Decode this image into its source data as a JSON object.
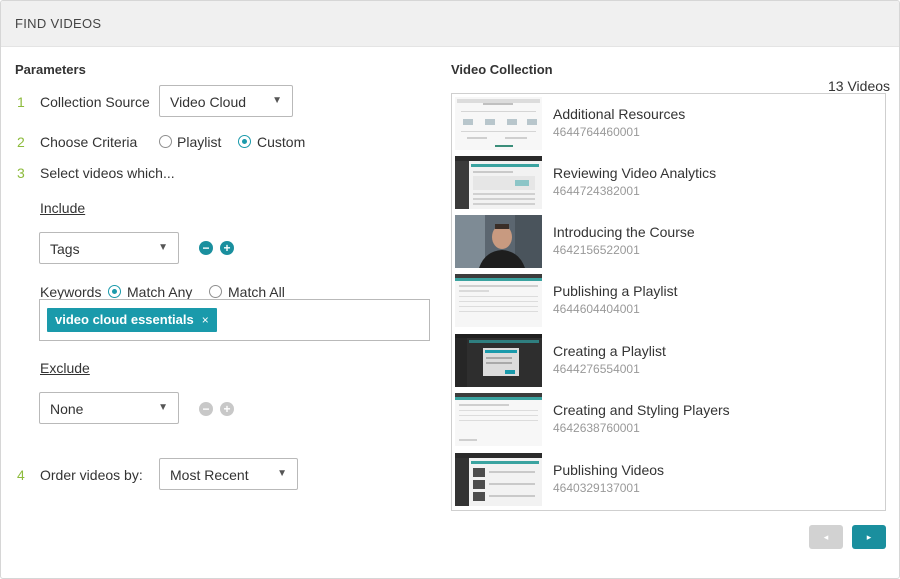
{
  "window": {
    "title": "FIND VIDEOS"
  },
  "parameters": {
    "heading": "Parameters",
    "steps": [
      {
        "num": "1",
        "label": "Collection Source"
      },
      {
        "num": "2",
        "label": "Choose Criteria"
      },
      {
        "num": "3",
        "label": "Select videos which..."
      },
      {
        "num": "4",
        "label": "Order videos by:"
      }
    ],
    "collection_source": "Video Cloud",
    "criteria_options": [
      "Playlist",
      "Custom"
    ],
    "criteria_selected": "Custom",
    "include": {
      "heading": "Include",
      "field": "Tags",
      "keywords_label": "Keywords",
      "match_options": [
        "Match Any",
        "Match All"
      ],
      "match_selected": "Match Any",
      "tags": [
        {
          "text": "video cloud essentials",
          "remove": "×"
        }
      ]
    },
    "exclude": {
      "heading": "Exclude",
      "field": "None"
    },
    "order_by": "Most Recent",
    "icons": {
      "add": "+",
      "remove": "−"
    }
  },
  "collection": {
    "heading": "Video Collection",
    "count_label": "13 Videos",
    "videos": [
      {
        "name": "Additional Resources",
        "id": "4644764460001",
        "thumb": "web-page"
      },
      {
        "name": "Reviewing Video Analytics",
        "id": "4644724382001",
        "thumb": "dark-dashboard"
      },
      {
        "name": "Introducing the Course",
        "id": "4642156522001",
        "thumb": "presenter"
      },
      {
        "name": "Publishing a Playlist",
        "id": "4644604404001",
        "thumb": "light-dashboard"
      },
      {
        "name": "Creating a Playlist",
        "id": "4644276554001",
        "thumb": "dark-dialog"
      },
      {
        "name": "Creating and Styling Players",
        "id": "4642638760001",
        "thumb": "light-dashboard"
      },
      {
        "name": "Publishing Videos",
        "id": "4640329137001",
        "thumb": "dark-dashboard"
      }
    ]
  },
  "pagination": {
    "prev_icon": "◂",
    "next_icon": "▸"
  },
  "colors": {
    "accent": "#1a9aab",
    "step_number": "#8dbb3c",
    "disabled": "#c8c8c8"
  }
}
